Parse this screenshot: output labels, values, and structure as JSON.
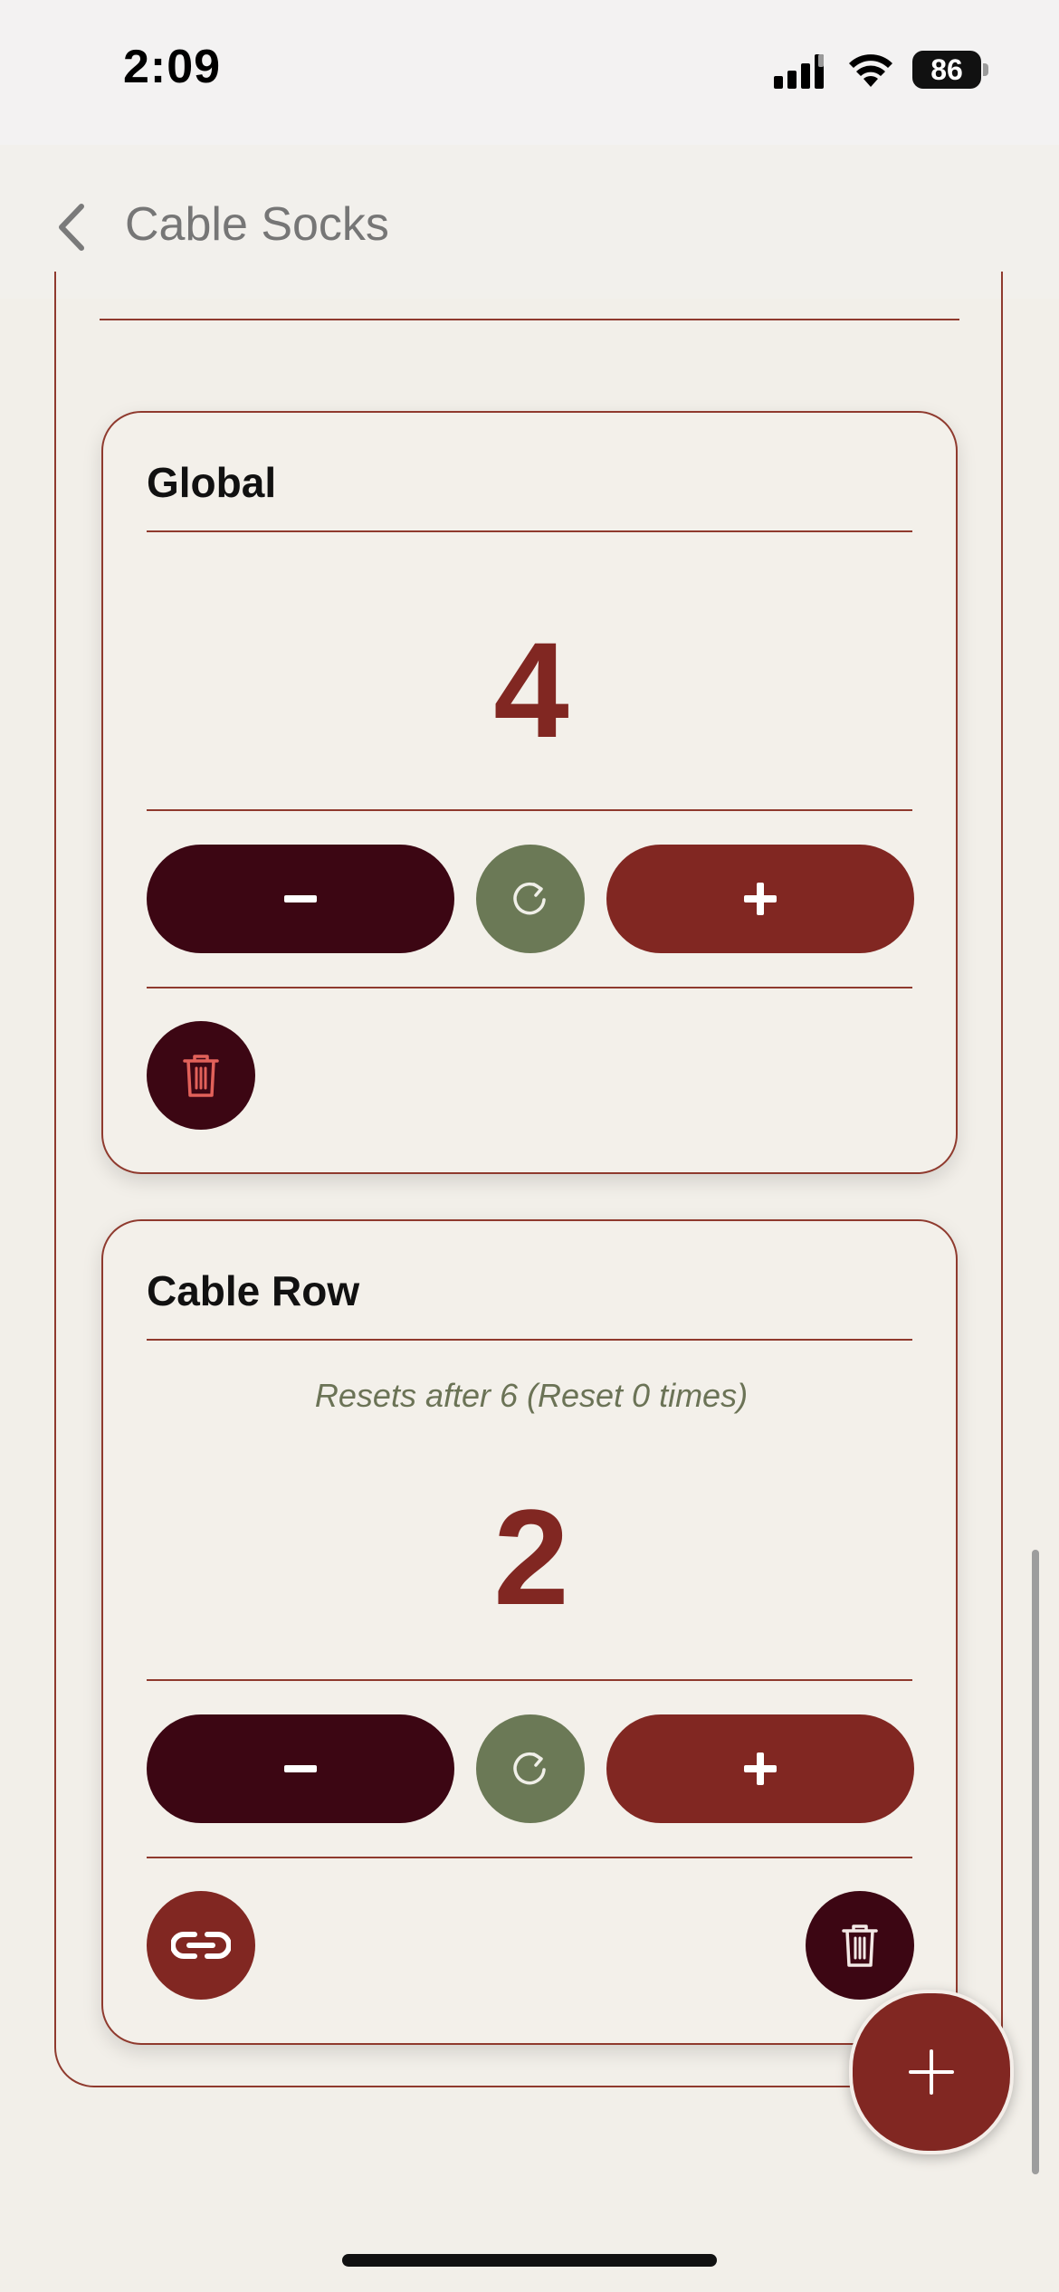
{
  "status_bar": {
    "time": "2:09",
    "battery": "86"
  },
  "nav": {
    "title": "Cable Socks"
  },
  "counters": [
    {
      "title": "Global",
      "count": "4",
      "minus_label": "−",
      "plus_label": "+"
    },
    {
      "title": "Cable Row",
      "subtitle": "Resets after 6 (Reset 0 times)",
      "count": "2",
      "minus_label": "−",
      "plus_label": "+"
    }
  ],
  "colors": {
    "accent": "#812722",
    "dark": "#3c0613",
    "reset": "#6b7956",
    "border": "#8f3a2e",
    "background": "#f2efe9",
    "subtitle": "#6b7356"
  },
  "icons": {
    "back": "chevron-left-icon",
    "reset": "refresh-icon",
    "delete": "trash-icon",
    "link": "link-icon",
    "add": "plus-icon"
  }
}
